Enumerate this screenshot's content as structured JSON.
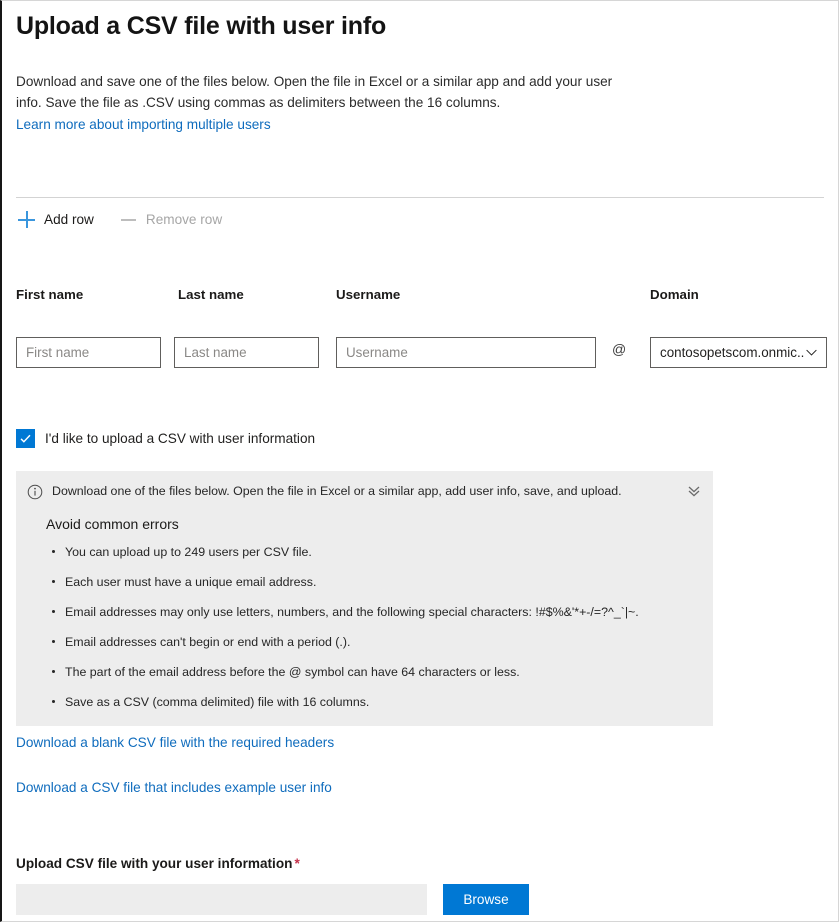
{
  "page": {
    "title": "Upload a CSV file with user info",
    "intro": "Download and save one of the files below. Open the file in Excel or a similar app and add your user info. Save the file as .CSV using commas as delimiters between the 16 columns.",
    "intro_link": "Learn more about importing multiple users"
  },
  "command_bar": {
    "add_row_label": "Add row",
    "remove_row_label": "Remove row",
    "add_icon": "plus-icon",
    "remove_icon": "minus-icon"
  },
  "form": {
    "labels": {
      "first_name": "First name",
      "last_name": "Last name",
      "username": "Username",
      "domain": "Domain"
    },
    "placeholders": {
      "first_name": "First name",
      "last_name": "Last name",
      "username": "Username"
    },
    "values": {
      "first_name": "",
      "last_name": "",
      "username": ""
    },
    "at_symbol": "@",
    "domain": {
      "selected": "contosopetscom.onmic...",
      "chevron_icon": "chevron-down-icon"
    }
  },
  "csv_checkbox": {
    "label": "I'd like to upload a CSV with user information",
    "checked": true,
    "icon": "checkmark-icon"
  },
  "info_panel": {
    "icon": "info-circle-icon",
    "collapse_icon": "double-chevron-down-icon",
    "message": "Download one of the files below. Open the file in Excel or a similar app, add user info, save, and upload.",
    "subtitle": "Avoid common errors",
    "bullets": [
      "You can upload up to 249 users per CSV file.",
      "Each user must have a unique email address.",
      "Email addresses may only use letters, numbers, and the following special characters: !#$%&'*+-/=?^_`|~.",
      "Email addresses can't begin or end with a period (.).",
      "The part of the email address before the @ symbol can have 64 characters or less.",
      "Save as a CSV (comma delimited) file with 16 columns."
    ]
  },
  "downloads": {
    "blank_csv": "Download a blank CSV file with the required headers",
    "example_csv": "Download a CSV file that includes example user info"
  },
  "upload": {
    "label": "Upload CSV file with your user information",
    "required_marker": "*",
    "file_value": "",
    "file_placeholder": "",
    "browse_label": "Browse"
  },
  "colors": {
    "accent": "#0078d4",
    "link": "#0f6cbd",
    "required": "#c4314b",
    "panel_bg": "#ededed"
  }
}
